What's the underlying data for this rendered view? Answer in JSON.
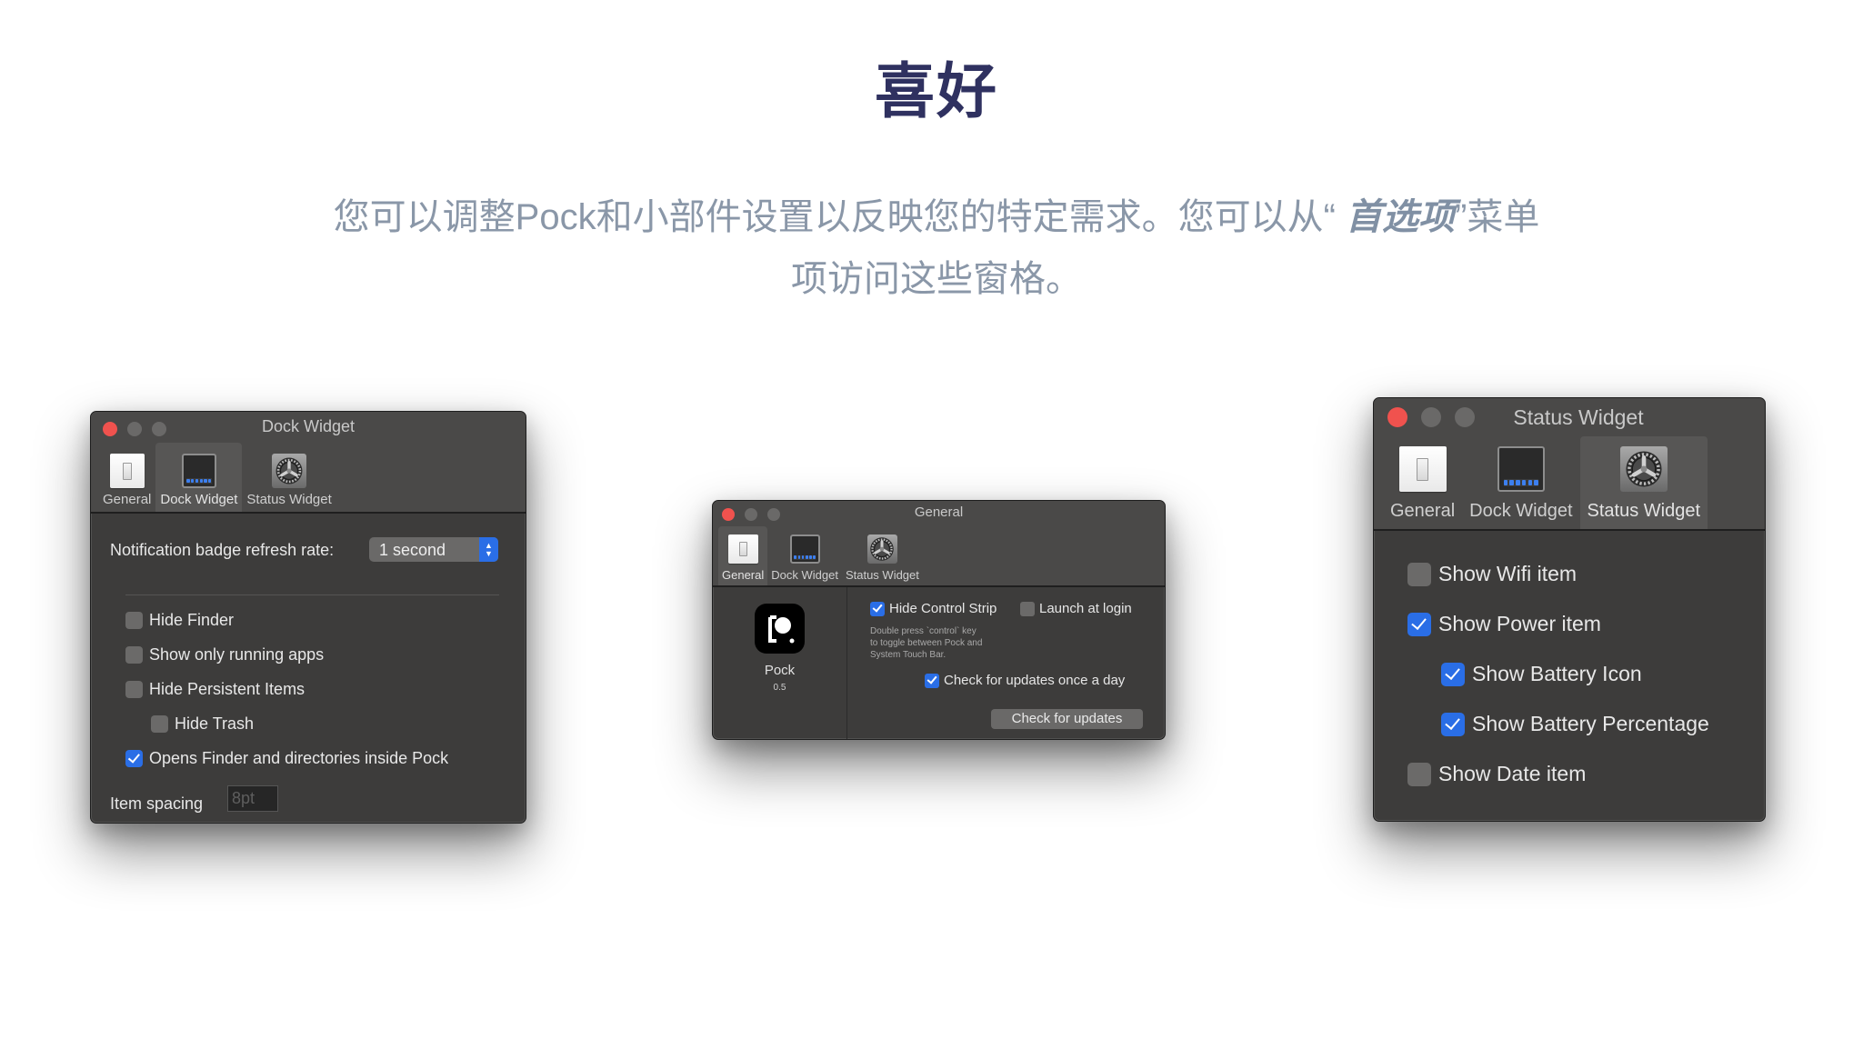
{
  "header": {
    "title": "喜好",
    "description_part1": "您可以调整Pock和小部件设置以反映您的特定需求。您可以从“ ",
    "description_emphasis": "首选项",
    "description_part2": "”菜单项访问这些窗格。"
  },
  "tabs": [
    "General",
    "Dock Widget",
    "Status Widget"
  ],
  "icons": {
    "general": "light-switch-icon",
    "dock": "dock-screen-icon",
    "status": "gear-icon"
  },
  "colors": {
    "title": "#2f3160",
    "description": "#8a97a8",
    "window_bg": "#3d3c3b",
    "checkbox_on": "#2a6ee6",
    "close_light": "#f0524e"
  },
  "dock_window": {
    "title": "Dock Widget",
    "active_tab": "Dock Widget",
    "refresh_label": "Notification badge refresh rate:",
    "refresh_value": "1 second",
    "options": [
      {
        "label": "Hide Finder",
        "checked": false
      },
      {
        "label": "Show only running apps",
        "checked": false
      },
      {
        "label": "Hide Persistent Items",
        "checked": false
      },
      {
        "label": "Hide Trash",
        "checked": false
      },
      {
        "label": "Opens Finder and directories inside Pock",
        "checked": true
      }
    ],
    "spacing_label": "Item spacing",
    "spacing_placeholder": "8pt"
  },
  "general_window": {
    "title": "General",
    "active_tab": "General",
    "app_name": "Pock",
    "app_version": "0.5",
    "hide_control_strip": {
      "label": "Hide Control Strip",
      "checked": true
    },
    "launch_at_login": {
      "label": "Launch at login",
      "checked": false
    },
    "hint": "Double press `control` key\nto toggle between Pock and\nSystem Touch Bar.",
    "check_updates_daily": {
      "label": "Check for updates once a day",
      "checked": true
    },
    "check_updates_button": "Check for updates"
  },
  "status_window": {
    "title": "Status Widget",
    "active_tab": "Status Widget",
    "options": [
      {
        "label": "Show Wifi item",
        "checked": false
      },
      {
        "label": "Show Power item",
        "checked": true
      },
      {
        "label": "Show Battery Icon",
        "checked": true
      },
      {
        "label": "Show Battery Percentage",
        "checked": true
      },
      {
        "label": "Show Date item",
        "checked": false
      }
    ]
  }
}
